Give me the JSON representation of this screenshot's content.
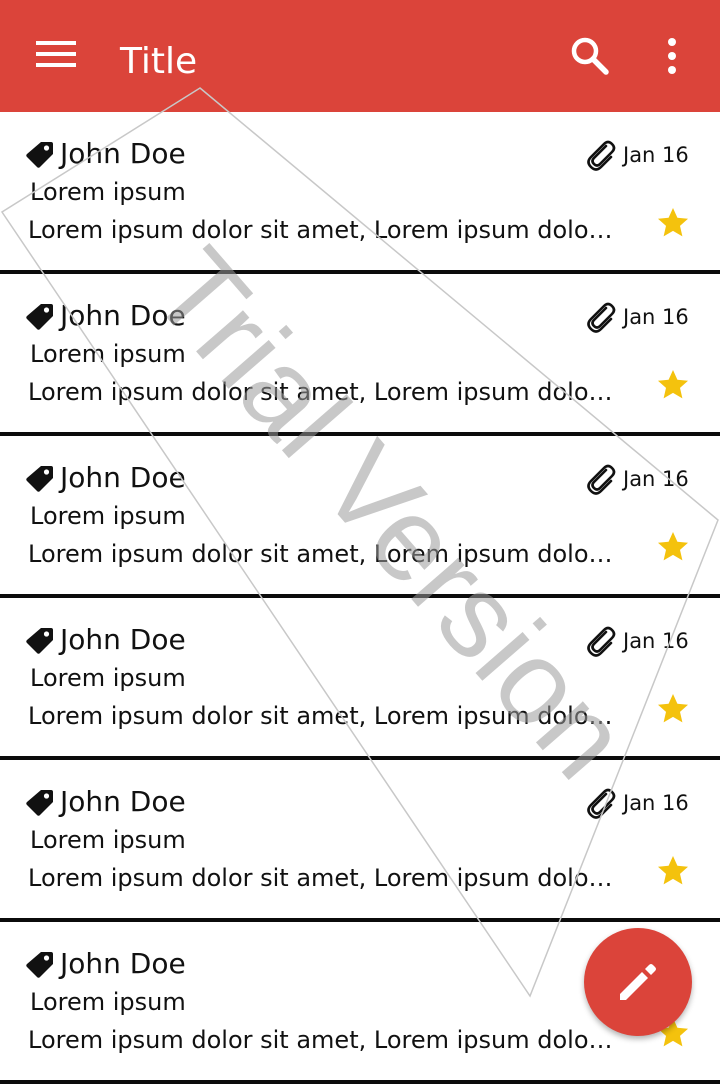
{
  "appbar": {
    "title": "Title",
    "icons": {
      "menu": "menu-icon",
      "search": "search-icon",
      "more": "more-vert-icon"
    },
    "color": "#db443a"
  },
  "list": {
    "items": [
      {
        "sender": "John Doe",
        "subject": "Lorem ipsum",
        "preview": "Lorem ipsum dolor sit amet, Lorem ipsum dolor sit amet",
        "date": "Jan 16",
        "has_attachment": true,
        "starred": true
      },
      {
        "sender": "John Doe",
        "subject": "Lorem ipsum",
        "preview": "Lorem ipsum dolor sit amet, Lorem ipsum dolor sit amet",
        "date": "Jan 16",
        "has_attachment": true,
        "starred": true
      },
      {
        "sender": "John Doe",
        "subject": "Lorem ipsum",
        "preview": "Lorem ipsum dolor sit amet, Lorem ipsum dolor sit amet",
        "date": "Jan 16",
        "has_attachment": true,
        "starred": true
      },
      {
        "sender": "John Doe",
        "subject": "Lorem ipsum",
        "preview": "Lorem ipsum dolor sit amet, Lorem ipsum dolor sit amet",
        "date": "Jan 16",
        "has_attachment": true,
        "starred": true
      },
      {
        "sender": "John Doe",
        "subject": "Lorem ipsum",
        "preview": "Lorem ipsum dolor sit amet, Lorem ipsum dolor sit amet",
        "date": "Jan 16",
        "has_attachment": true,
        "starred": true
      },
      {
        "sender": "John Doe",
        "subject": "Lorem ipsum",
        "preview": "Lorem ipsum dolor sit amet, Lorem ipsum dolor sit amet",
        "date": "",
        "has_attachment": false,
        "starred": true
      }
    ],
    "icons": {
      "tag": "label-tag-icon",
      "attachment": "paperclip-icon",
      "star": "star-icon"
    },
    "star_color": "#f4c20d"
  },
  "watermark": {
    "text": "Trial Version"
  },
  "fab": {
    "icon": "pencil-edit-icon",
    "color": "#db443a"
  }
}
